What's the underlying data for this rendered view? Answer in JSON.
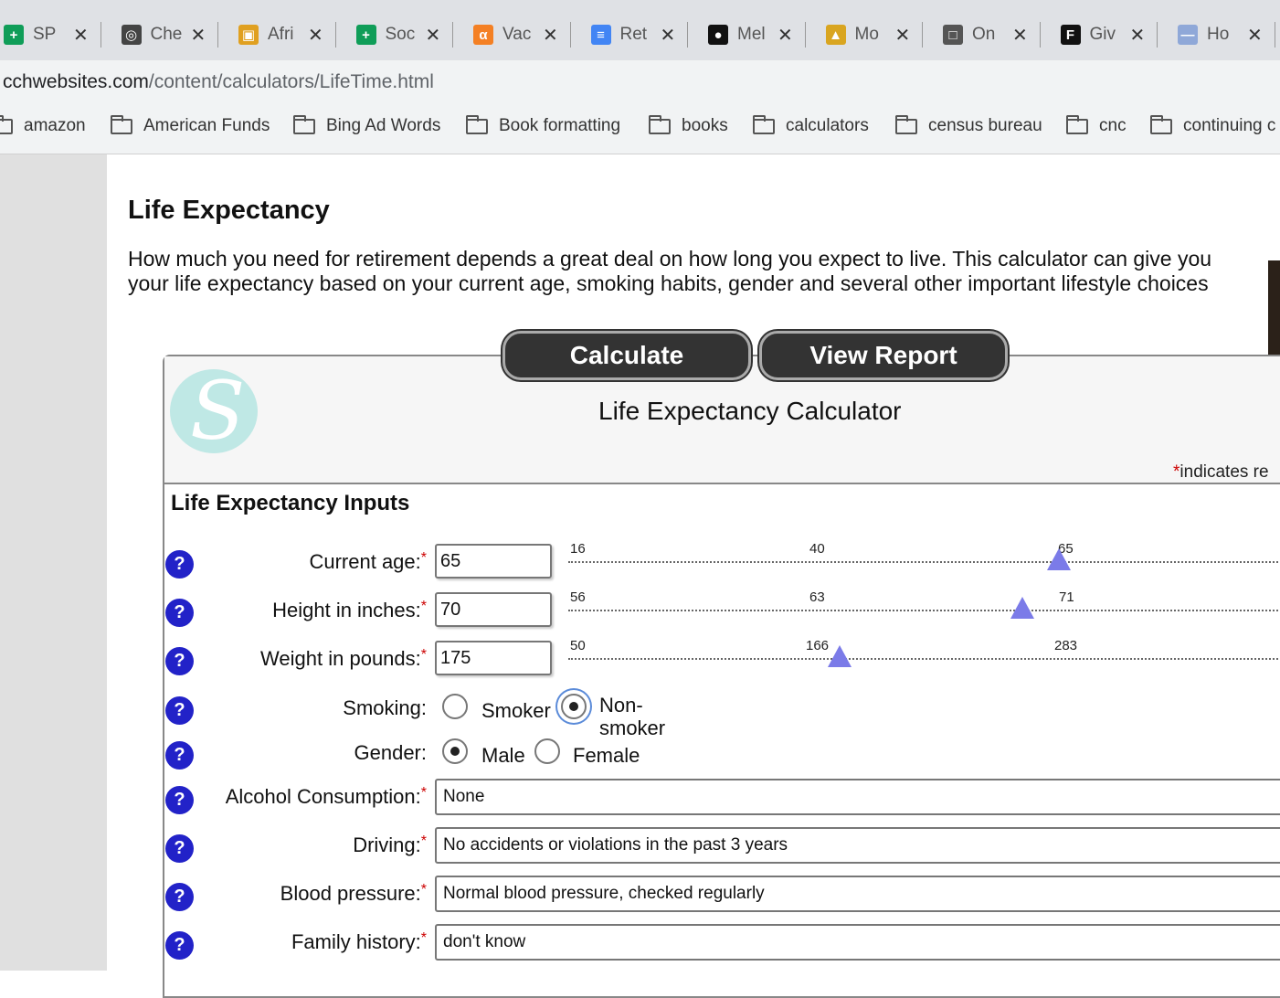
{
  "browser": {
    "tabs": [
      {
        "label": "SP",
        "icon": "sheets-icon",
        "color": "#0f9d58"
      },
      {
        "label": "Che",
        "icon": "globe-icon",
        "color": "#444444"
      },
      {
        "label": "Afri",
        "icon": "image-icon",
        "color": "#e0a020"
      },
      {
        "label": "Soc",
        "icon": "sheets-icon",
        "color": "#0f9d58"
      },
      {
        "label": "Vac",
        "icon": "alpha-icon",
        "color": "#f48024"
      },
      {
        "label": "Ret",
        "icon": "docs-icon",
        "color": "#4285f4"
      },
      {
        "label": "Mel",
        "icon": "abc-icon",
        "color": "#111111"
      },
      {
        "label": "Mo",
        "icon": "person-icon",
        "color": "#d9a520"
      },
      {
        "label": "On",
        "icon": "lock-icon",
        "color": "#555555"
      },
      {
        "label": "Giv",
        "icon": "f-icon",
        "color": "#111111"
      },
      {
        "label": "Ho",
        "icon": "page-icon",
        "color": "#8fa8d8"
      }
    ],
    "address": {
      "host": "cchwebsites.com",
      "path": "/content/calculators/LifeTime.html"
    },
    "bookmarks": [
      "amazon",
      "American Funds",
      "Bing Ad Words",
      "Book formatting",
      "books",
      "calculators",
      "census bureau",
      "cnc",
      "continuing c"
    ]
  },
  "page": {
    "heading": "Life Expectancy",
    "intro_line1": "How much you need for retirement depends a great deal on how long you expect to live. This calculator can give you",
    "intro_line2": "your life expectancy based on your current age, smoking habits, gender and several other important lifestyle choices"
  },
  "calculator": {
    "calculate_label": "Calculate",
    "report_label": "View Report",
    "title": "Life Expectancy Calculator",
    "required_star": "*",
    "required_note": "indicates re",
    "inputs_heading": "Life Expectancy Inputs",
    "help_glyph": "?",
    "age": {
      "label": "Current age:",
      "value": "65",
      "ticks": [
        "16",
        "40",
        "65"
      ],
      "slider_value": 65
    },
    "height": {
      "label": "Height in inches:",
      "value": "70",
      "ticks": [
        "56",
        "63",
        "71"
      ],
      "slider_value": 70
    },
    "weight": {
      "label": "Weight in pounds:",
      "value": "175",
      "ticks": [
        "50",
        "166",
        "283"
      ],
      "slider_value": 175
    },
    "smoking": {
      "label": "Smoking:",
      "options": [
        "Smoker",
        "Non-",
        "smoker"
      ],
      "selected": "Non-smoker"
    },
    "gender": {
      "label": "Gender:",
      "options": [
        "Male",
        "Female"
      ],
      "selected": "Male"
    },
    "alcohol": {
      "label": "Alcohol Consumption:",
      "value": "None"
    },
    "driving": {
      "label": "Driving:",
      "value": "No accidents or violations in the past 3 years"
    },
    "blood_pressure": {
      "label": "Blood pressure:",
      "value": "Normal blood pressure, checked regularly"
    },
    "family_history": {
      "label": "Family history:",
      "value": "don't know"
    }
  }
}
